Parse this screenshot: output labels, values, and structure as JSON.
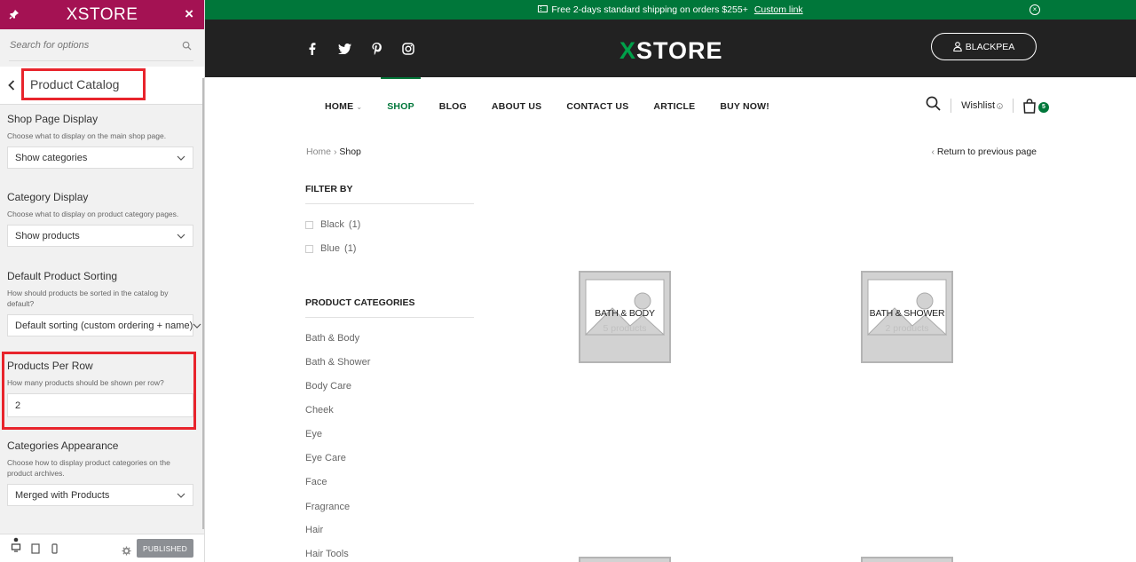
{
  "panel": {
    "logo": "XSTORE",
    "search_placeholder": "Search for options",
    "section_title": "Product Catalog",
    "options": [
      {
        "label": "Shop Page Display",
        "description": "Choose what to display on the main shop page.",
        "value": "Show categories"
      },
      {
        "label": "Category Display",
        "description": "Choose what to display on product category pages.",
        "value": "Show products"
      },
      {
        "label": "Default Product Sorting",
        "description": "How should products be sorted in the catalog by default?",
        "value": "Default sorting (custom ordering + name)"
      },
      {
        "label": "Products Per Row",
        "description": "How many products should be shown per row?",
        "value": "2"
      },
      {
        "label": "Categories Appearance",
        "description": "Choose how to display product categories on the product archives.",
        "value": "Merged with Products"
      }
    ],
    "publish_label": "PUBLISHED",
    "accent_color": "#a41253",
    "highlight_color": "#e8242c"
  },
  "site": {
    "topbar": {
      "text": "Free 2-days standard shipping on orders $255+",
      "link": "Custom link",
      "color": "#00773a"
    },
    "logo": {
      "x": "X",
      "rest": "STORE"
    },
    "account_label": "BLACKPEA",
    "nav": [
      {
        "label": "HOME",
        "has_dropdown": true
      },
      {
        "label": "SHOP",
        "active": true
      },
      {
        "label": "BLOG"
      },
      {
        "label": "ABOUT US"
      },
      {
        "label": "CONTACT US"
      },
      {
        "label": "ARTICLE"
      },
      {
        "label": "BUY NOW!"
      }
    ],
    "wishlist_label": "Wishlist",
    "cart_count": "5",
    "breadcrumb": {
      "home": "Home",
      "current": "Shop"
    },
    "return_link": "Return to previous page",
    "filter_title": "FILTER BY",
    "filters": [
      {
        "label": "Black",
        "count": "(1)"
      },
      {
        "label": "Blue",
        "count": "(1)"
      }
    ],
    "categories_title": "PRODUCT CATEGORIES",
    "categories": [
      "Bath & Body",
      "Bath & Shower",
      "Body Care",
      "Cheek",
      "Eye",
      "Eye Care",
      "Face",
      "Fragrance",
      "Hair",
      "Hair Tools"
    ],
    "category_cards": [
      {
        "name": "Bath & Body",
        "count": "5 products"
      },
      {
        "name": "Bath & Shower",
        "count": "2 products"
      }
    ]
  }
}
